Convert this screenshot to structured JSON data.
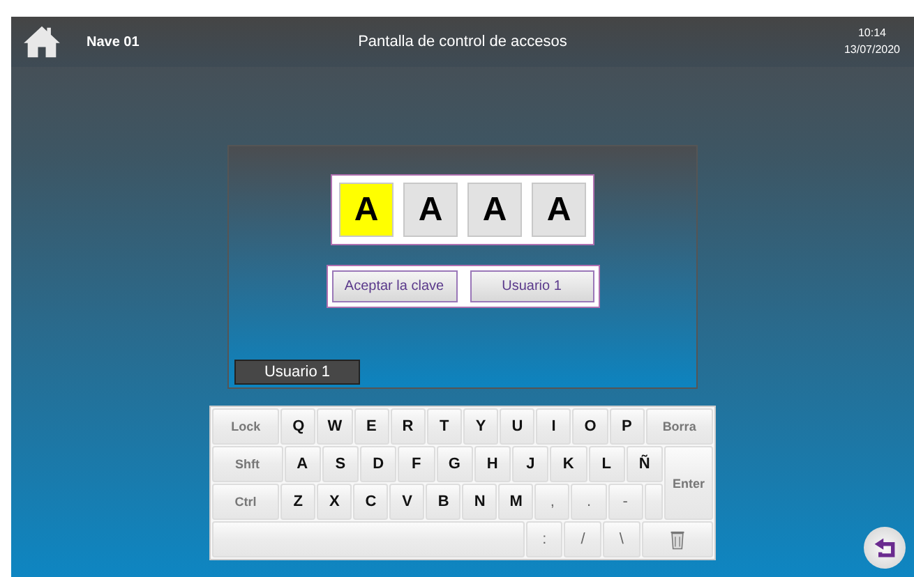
{
  "header": {
    "location": "Nave 01",
    "title": "Pantalla de control de accesos",
    "time": "10:14",
    "date": "13/07/2020"
  },
  "code_slots": [
    {
      "char": "A",
      "selected": true
    },
    {
      "char": "A",
      "selected": false
    },
    {
      "char": "A",
      "selected": false
    },
    {
      "char": "A",
      "selected": false
    }
  ],
  "buttons": [
    "Aceptar la clave",
    "Usuario 1"
  ],
  "user_badge": "Usuario 1",
  "keyboard": {
    "row_1": [
      {
        "label": "Lock",
        "kind": "function"
      },
      {
        "label": "Q",
        "kind": "letter"
      },
      {
        "label": "W",
        "kind": "letter"
      },
      {
        "label": "E",
        "kind": "letter"
      },
      {
        "label": "R",
        "kind": "letter"
      },
      {
        "label": "T",
        "kind": "letter"
      },
      {
        "label": "Y",
        "kind": "letter"
      },
      {
        "label": "U",
        "kind": "letter"
      },
      {
        "label": "I",
        "kind": "letter"
      },
      {
        "label": "O",
        "kind": "letter"
      },
      {
        "label": "P",
        "kind": "letter"
      },
      {
        "label": "Borra",
        "kind": "function"
      }
    ],
    "row_2": [
      {
        "label": "Shft",
        "kind": "function"
      },
      {
        "label": "A",
        "kind": "letter"
      },
      {
        "label": "S",
        "kind": "letter"
      },
      {
        "label": "D",
        "kind": "letter"
      },
      {
        "label": "F",
        "kind": "letter"
      },
      {
        "label": "G",
        "kind": "letter"
      },
      {
        "label": "H",
        "kind": "letter"
      },
      {
        "label": "J",
        "kind": "letter"
      },
      {
        "label": "K",
        "kind": "letter"
      },
      {
        "label": "L",
        "kind": "letter"
      },
      {
        "label": "Ñ",
        "kind": "letter"
      }
    ],
    "row_3": [
      {
        "label": "Ctrl",
        "kind": "function"
      },
      {
        "label": "Z",
        "kind": "letter"
      },
      {
        "label": "X",
        "kind": "letter"
      },
      {
        "label": "C",
        "kind": "letter"
      },
      {
        "label": "V",
        "kind": "letter"
      },
      {
        "label": "B",
        "kind": "letter"
      },
      {
        "label": "N",
        "kind": "letter"
      },
      {
        "label": "M",
        "kind": "letter"
      },
      {
        "label": ",",
        "kind": "symbol"
      },
      {
        "label": ".",
        "kind": "symbol"
      },
      {
        "label": "-",
        "kind": "symbol"
      },
      {
        "kind": "blank"
      }
    ],
    "enter": "Enter",
    "row_4": [
      {
        "kind": "space"
      },
      {
        "label": ":",
        "kind": "symbol"
      },
      {
        "label": "/",
        "kind": "symbol"
      },
      {
        "label": "\\",
        "kind": "symbol"
      },
      {
        "kind": "trash"
      }
    ]
  }
}
